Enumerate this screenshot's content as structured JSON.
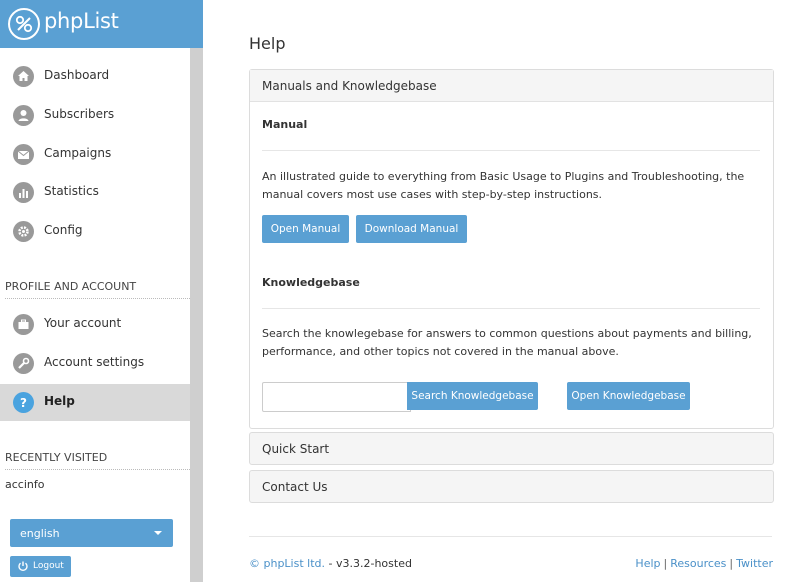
{
  "brand": {
    "name": "phpList"
  },
  "sidebar": {
    "main_items": [
      {
        "label": "Dashboard",
        "icon": "home-icon"
      },
      {
        "label": "Subscribers",
        "icon": "user-icon"
      },
      {
        "label": "Campaigns",
        "icon": "envelope-icon"
      },
      {
        "label": "Statistics",
        "icon": "bar-chart-icon"
      },
      {
        "label": "Config",
        "icon": "gear-icon"
      }
    ],
    "profile_heading": "PROFILE AND ACCOUNT",
    "profile_items": [
      {
        "label": "Your account",
        "icon": "briefcase-icon"
      },
      {
        "label": "Account settings",
        "icon": "wrench-icon"
      },
      {
        "label": "Help",
        "icon": "question-icon",
        "active": true
      }
    ],
    "recent_heading": "RECENTLY VISITED",
    "recent_items": [
      "accinfo"
    ],
    "language": "english",
    "logout_label": "Logout"
  },
  "main": {
    "title": "Help",
    "panel": {
      "title": "Manuals and Knowledgebase",
      "manual_heading": "Manual",
      "manual_text": "An illustrated guide to everything from Basic Usage to Plugins and Troubleshooting, the manual covers most use cases with step-by-step instructions.",
      "open_manual": "Open Manual",
      "download_manual": "Download Manual",
      "kb_heading": "Knowledgebase",
      "kb_text": "Search the knowlegebase for answers to common questions about payments and billing, performance, and other topics not covered in the manual above.",
      "kb_input_value": "",
      "search_kb": "Search Knowledgebase",
      "open_kb": "Open Knowledgebase"
    },
    "quick_start": "Quick Start",
    "contact_us": "Contact Us"
  },
  "footer": {
    "copyright_link": "© phpList ltd.",
    "version": " - v3.3.2-hosted",
    "links": [
      "Help",
      "Resources",
      "Twitter"
    ]
  },
  "colors": {
    "accent": "#5aa0d3",
    "active_bg": "#d9d9d9",
    "icon_grey": "#999999",
    "link": "#4a90c8"
  }
}
